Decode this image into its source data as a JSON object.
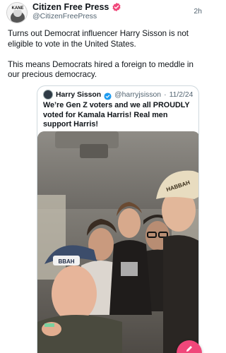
{
  "post": {
    "display_name": "Citizen Free Press",
    "handle": "@CitizenFreePress",
    "timestamp": "2h",
    "avatar_text": "KANE",
    "text_paragraphs": [
      "Turns out Democrat influencer Harry Sisson is not eligible to vote in the United States.",
      "This means Democrats hired a foreign to meddle in our precious democracy."
    ]
  },
  "quoted_post": {
    "display_name": "Harry Sisson",
    "handle": "@harryjsisson",
    "separator": "·",
    "date": "11/2/24",
    "text": "We’re Gen Z voters and we all PROUDLY voted for Kamala Harris! Real men support Harris!",
    "photo_caption_left": "BBAH",
    "photo_caption_right": "HABBAH"
  },
  "icons": {
    "verified": "verified-badge-icon",
    "compose": "compose-icon"
  },
  "colors": {
    "verified_badge": "#f0477a",
    "fab": "#f0477a",
    "secondary_text": "#536471"
  }
}
